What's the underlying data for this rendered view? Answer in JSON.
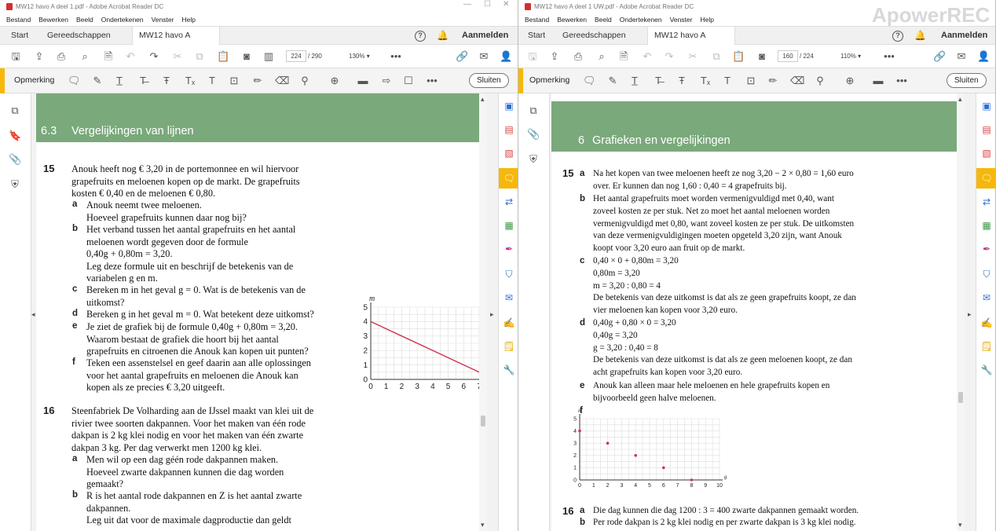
{
  "left_window": {
    "title": "MW12 havo A deel 1.pdf - Adobe Acrobat Reader DC",
    "menu": [
      "Bestand",
      "Bewerken",
      "Beeld",
      "Ondertekenen",
      "Venster",
      "Help"
    ],
    "tabs": {
      "start": "Start",
      "tools": "Gereedschappen",
      "doc": "MW12 havo A deel..."
    },
    "signin": "Aanmelden",
    "page_current": "224",
    "page_total": "/ 290",
    "zoom": "130%",
    "comment_label": "Opmerking",
    "close_label": "Sluiten",
    "section_number": "6.3",
    "section_title": "Vergelijkingen van lijnen",
    "ex15": {
      "num": "15",
      "intro": [
        "Anouk heeft nog € 3,20 in de portemonnee en wil hiervoor",
        "grapefruits en meloenen kopen op de markt. De grapefruits",
        "kosten € 0,40 en de meloenen € 0,80."
      ],
      "a": [
        "Anouk neemt twee meloenen.",
        "Hoeveel grapefruits kunnen daar nog bij?"
      ],
      "b": [
        "Het verband tussen het aantal grapefruits en het aantal",
        "meloenen wordt gegeven door de formule",
        "0,40g + 0,80m = 3,20.",
        "Leg deze formule uit en beschrijf de betekenis van de",
        "variabelen g en m."
      ],
      "c": [
        "Bereken m in het geval g = 0. Wat is de betekenis van de",
        "uitkomst?"
      ],
      "d": [
        "Bereken g in het geval m = 0. Wat betekent deze uitkomst?"
      ],
      "e": [
        "Je ziet de grafiek bij de formule 0,40g + 0,80m = 3,20.",
        "Waarom bestaat de grafiek die hoort bij het aantal",
        "grapefruits en citroenen die Anouk kan kopen uit punten?"
      ],
      "f": [
        "Teken een assenstelsel en geef daarin aan alle oplossingen",
        "voor het aantal grapefruits en meloenen die Anouk kan",
        "kopen als ze precies € 3,20 uitgeeft."
      ]
    },
    "ex16": {
      "num": "16",
      "intro": [
        "Steenfabriek De Volharding aan de IJssel maakt van klei uit de",
        "rivier twee soorten dakpannen. Voor het maken van één rode",
        "dakpan is 2 kg klei nodig en voor het maken van één zwarte",
        "dakpan 3 kg. Per dag verwerkt men 1200 kg klei."
      ],
      "a": [
        "Men wil op een dag géén rode dakpannen maken.",
        "Hoeveel zwarte dakpannen kunnen die dag worden",
        "gemaakt?"
      ],
      "b": [
        "R is het aantal rode dakpannen en Z is het aantal zwarte",
        "dakpannen.",
        "Leg uit dat voor de maximale dagproductie dan geldt"
      ]
    },
    "letters": {
      "a": "a",
      "b": "b",
      "c": "c",
      "d": "d",
      "e": "e",
      "f": "f"
    }
  },
  "right_window": {
    "title": "MW12 havo A deel 1 UW.pdf - Adobe Acrobat Reader DC",
    "menu": [
      "Bestand",
      "Bewerken",
      "Beeld",
      "Ondertekenen",
      "Venster",
      "Help"
    ],
    "tabs": {
      "start": "Start",
      "tools": "Gereedschappen",
      "doc": "MW12 havo A deel..."
    },
    "signin": "Aanmelden",
    "page_current": "160",
    "page_total": "/ 224",
    "zoom": "110%",
    "comment_label": "Opmerking",
    "close_label": "Sluiten",
    "watermark": "ApowerREC",
    "section_number": "6",
    "section_title": "Grafieken en vergelijkingen",
    "ans15": {
      "num": "15",
      "a": [
        "Na het kopen van twee meloenen heeft ze nog 3,20 − 2 × 0,80 = 1,60 euro",
        "over. Er kunnen dan nog 1,60 : 0,40 = 4 grapefruits bij."
      ],
      "b": [
        "Het aantal grapefruits moet worden vermenigvuldigd met 0,40, want",
        "zoveel kosten ze per stuk. Net zo moet het aantal meloenen worden",
        "vermenigvuldigd met 0,80, want zoveel kosten ze per stuk. De uitkomsten",
        "van deze vermenigvuldigingen moeten opgeteld 3,20 zijn, want Anouk",
        "koopt voor 3,20 euro aan fruit op de markt."
      ],
      "c": [
        "0,40 × 0 + 0,80m = 3,20",
        "0,80m = 3,20",
        "m = 3,20 : 0,80 = 4",
        "De betekenis van deze uitkomst is dat als ze geen grapefruits koopt, ze dan",
        "vier meloenen kan kopen voor 3,20 euro."
      ],
      "d": [
        "0,40g + 0,80 × 0 = 3,20",
        "0,40g = 3,20",
        "g = 3,20 : 0,40 = 8",
        "De betekenis van deze uitkomst is dat als ze geen meloenen koopt, ze dan",
        "acht grapefruits kan kopen voor 3,20 euro."
      ],
      "e": [
        "Anouk kan alleen maar hele meloenen en hele grapefruits kopen en",
        "bijvoorbeeld geen halve meloenen."
      ],
      "f_label": "f"
    },
    "ans16": {
      "num": "16",
      "a": [
        "Die dag kunnen die dag 1200 : 3 = 400 zwarte dakpannen gemaakt worden."
      ],
      "b": [
        "Per rode dakpan is 2 kg klei nodig en per zwarte dakpan is 3 kg klei nodig."
      ]
    },
    "letters": {
      "a": "a",
      "b": "b",
      "c": "c",
      "d": "d",
      "e": "e",
      "f": "f"
    }
  },
  "chart_data": [
    {
      "type": "line",
      "title": "",
      "xlabel": "",
      "ylabel": "m",
      "xlim": [
        0,
        7
      ],
      "ylim": [
        0,
        5
      ],
      "x_ticks": [
        "0",
        "1",
        "2",
        "3",
        "4",
        "5",
        "6",
        "7"
      ],
      "y_ticks": [
        "0",
        "1",
        "2",
        "3",
        "4",
        "5"
      ],
      "series": [
        {
          "x": [
            0,
            7
          ],
          "y": [
            4,
            0.5
          ]
        }
      ],
      "line_color": "#d0344f",
      "grid": true
    },
    {
      "type": "scatter",
      "title": "",
      "xlabel": "g",
      "ylabel": "m",
      "xlim": [
        0,
        10
      ],
      "ylim": [
        0,
        5
      ],
      "x_ticks": [
        "0",
        "1",
        "2",
        "3",
        "4",
        "5",
        "6",
        "7",
        "8",
        "9",
        "10"
      ],
      "y_ticks": [
        "0",
        "1",
        "2",
        "3",
        "4",
        "5"
      ],
      "series": [
        {
          "x": [
            0,
            2,
            4,
            6,
            8
          ],
          "y": [
            4,
            3,
            2,
            1,
            0
          ]
        }
      ],
      "point_color": "#d0344f",
      "grid": true
    }
  ]
}
